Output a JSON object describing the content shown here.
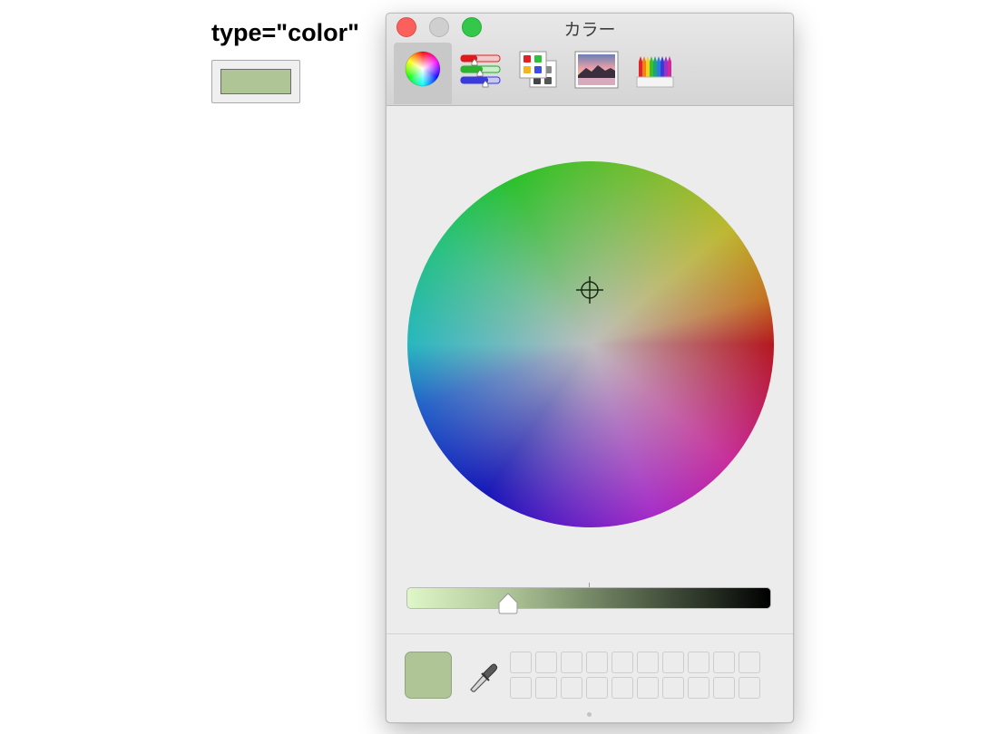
{
  "page": {
    "heading": "type=\"color\"",
    "input_color": "#afc596"
  },
  "panel": {
    "title": "カラー",
    "traffic_lights": [
      "close",
      "minimize",
      "zoom"
    ],
    "tabs": [
      {
        "icon": "color-wheel-icon",
        "selected": true
      },
      {
        "icon": "color-sliders-icon",
        "selected": false
      },
      {
        "icon": "color-palettes-icon",
        "selected": false
      },
      {
        "icon": "image-palettes-icon",
        "selected": false
      },
      {
        "icon": "pencils-icon",
        "selected": false
      }
    ],
    "brightness_level": 0.28,
    "current_color": "#afc596",
    "favorite_slots": 20
  },
  "colors": {
    "close": "#fc605c",
    "minimize": "#cfcfcf",
    "zoom": "#34c84a"
  }
}
